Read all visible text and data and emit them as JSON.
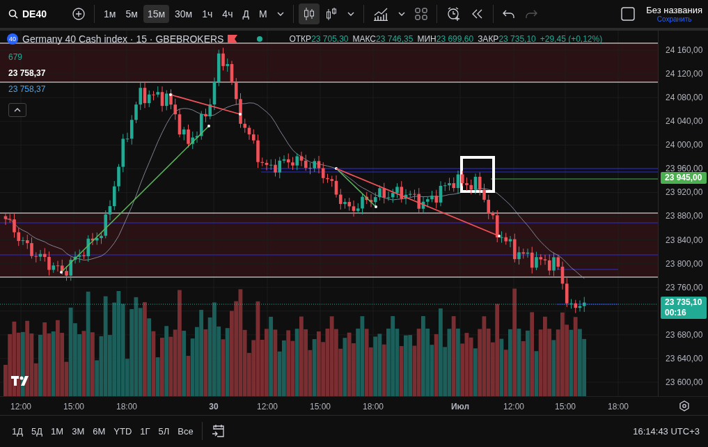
{
  "toolbar": {
    "symbol": "DE40",
    "intervals": [
      {
        "label": "1м",
        "selected": false
      },
      {
        "label": "5м",
        "selected": false
      },
      {
        "label": "15м",
        "selected": true
      },
      {
        "label": "30м",
        "selected": false
      },
      {
        "label": "1ч",
        "selected": false
      },
      {
        "label": "4ч",
        "selected": false
      },
      {
        "label": "Д",
        "selected": false
      },
      {
        "label": "М",
        "selected": false
      }
    ],
    "layout_title": "Без названия",
    "save_label": "Сохранить"
  },
  "legend": {
    "badge": "40",
    "title": "Germany 40 Cash index · 15 · GBEBROKERS",
    "ohlc": [
      {
        "label": "ОТКР",
        "value": "23 705,30"
      },
      {
        "label": "МАКС",
        "value": "23 746,35"
      },
      {
        "label": "МИН",
        "value": "23 699,60"
      },
      {
        "label": "ЗАКР",
        "value": "23 735,10"
      }
    ],
    "change": "+29,45 (+0,12%)",
    "indicators": [
      {
        "value": "679",
        "color": "#22ab94"
      },
      {
        "value": "23 758,37",
        "color": "#ffffff"
      },
      {
        "value": "23 758,37",
        "color": "#42a5f5"
      }
    ]
  },
  "price_axis": {
    "ticks": [
      "24 160,00",
      "24 120,00",
      "24 080,00",
      "24 040,00",
      "24 000,00",
      "23 960,00",
      "23 920,00",
      "23 880,00",
      "23 840,00",
      "23 800,00",
      "23 760,00",
      "23 680,00",
      "23 640,00",
      "23 600,00"
    ],
    "markers": [
      {
        "value": "23 945,00",
        "color": "#4caf50"
      },
      {
        "value": "23 735,10",
        "timer": "00:16",
        "color": "#22ab94"
      }
    ]
  },
  "time_axis": [
    {
      "label": "12:00",
      "bold": false
    },
    {
      "label": "15:00",
      "bold": false
    },
    {
      "label": "18:00",
      "bold": false
    },
    {
      "label": "30",
      "bold": true
    },
    {
      "label": "12:00",
      "bold": false
    },
    {
      "label": "15:00",
      "bold": false
    },
    {
      "label": "18:00",
      "bold": false
    },
    {
      "label": "Июл",
      "bold": true
    },
    {
      "label": "12:00",
      "bold": false
    },
    {
      "label": "15:00",
      "bold": false
    },
    {
      "label": "18:00",
      "bold": false
    }
  ],
  "ranges": [
    "1Д",
    "5Д",
    "1М",
    "3М",
    "6М",
    "YTD",
    "1Г",
    "5Л",
    "Все"
  ],
  "clock": "16:14:43 UTC+3"
}
